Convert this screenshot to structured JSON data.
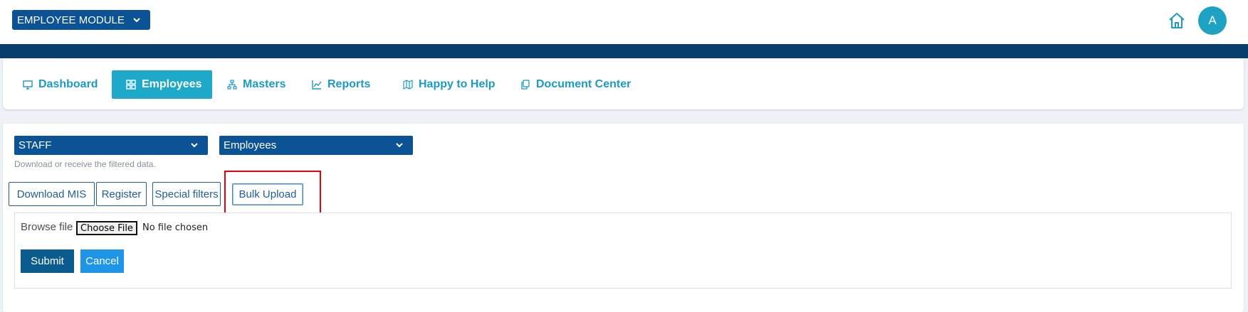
{
  "header": {
    "module_label": "EMPLOYEE MODULE",
    "avatar_initial": "A"
  },
  "nav": {
    "items": [
      {
        "label": "Dashboard",
        "icon": "monitor-icon"
      },
      {
        "label": "Employees",
        "icon": "grid-icon",
        "active": true
      },
      {
        "label": "Masters",
        "icon": "sitemap-icon"
      },
      {
        "label": "Reports",
        "icon": "chart-line-icon"
      },
      {
        "label": "Happy to Help",
        "icon": "map-icon"
      },
      {
        "label": "Document Center",
        "icon": "copy-icon"
      }
    ]
  },
  "filters": {
    "category_value": "STAFF",
    "type_value": "Employees",
    "hint": "Download or receive the filtered data."
  },
  "actions": {
    "download_mis": "Download MIS",
    "register": "Register",
    "special_filters": "Special filters",
    "bulk_upload": "Bulk Upload"
  },
  "upload": {
    "browse_label": "Browse file",
    "choose_file": "Choose File",
    "no_file": "No file chosen",
    "submit": "Submit",
    "cancel": "Cancel"
  },
  "colors": {
    "brand_navy": "#0b5394",
    "accent_teal": "#1ea8c9",
    "highlight_red": "#e8000b"
  }
}
